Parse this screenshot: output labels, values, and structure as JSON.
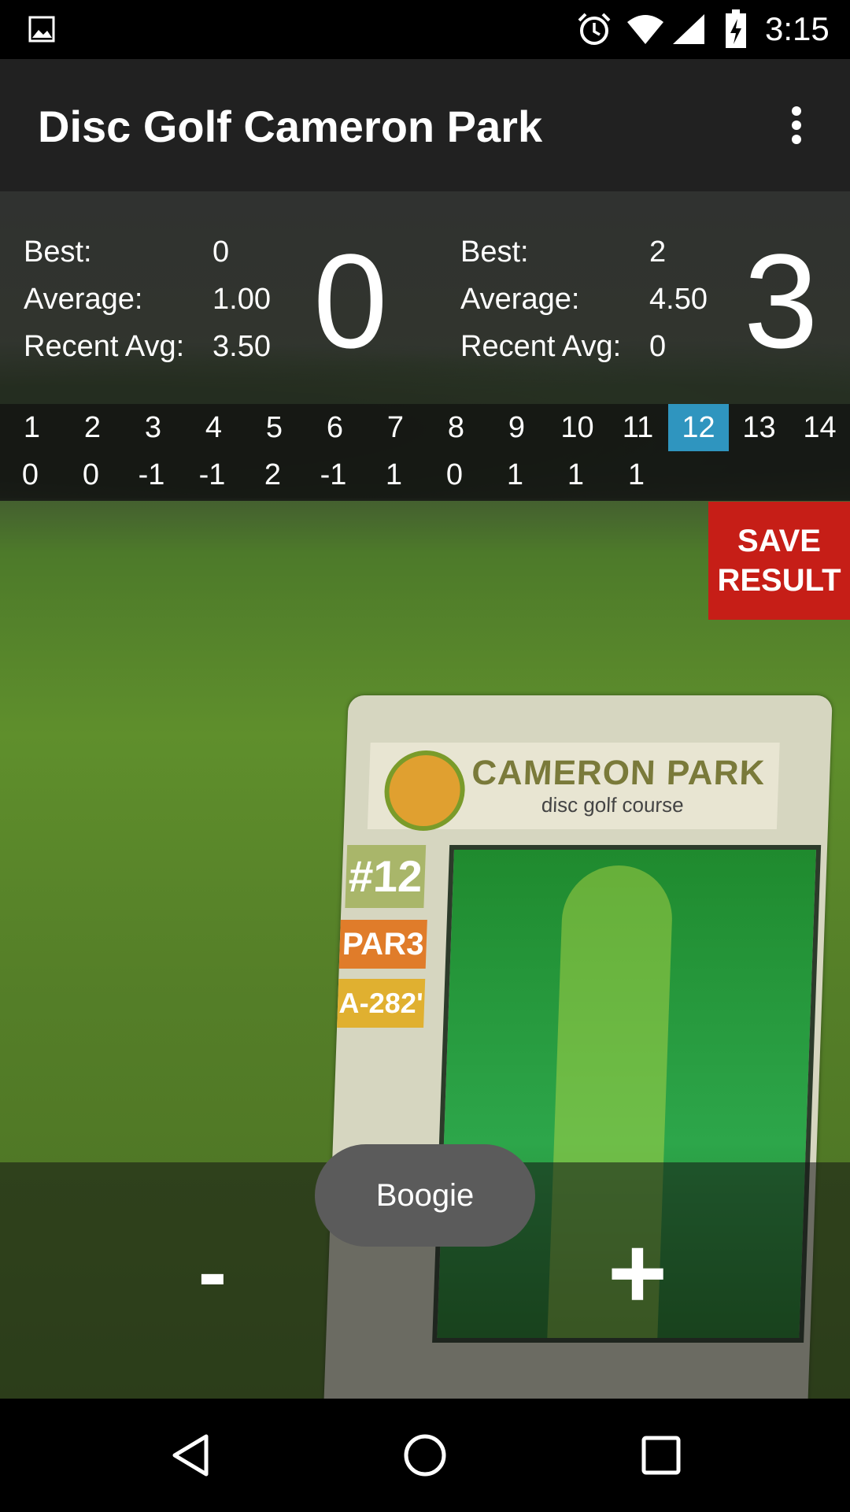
{
  "status_bar": {
    "time": "3:15",
    "icons": [
      "gallery-icon",
      "alarm-icon",
      "wifi-icon",
      "signal-icon",
      "battery-charging-icon"
    ]
  },
  "app_bar": {
    "title": "Disc Golf Cameron Park",
    "menu_icon": "overflow-menu-icon"
  },
  "player_left": {
    "best_label": "Best:",
    "best_value": "0",
    "average_label": "Average:",
    "average_value": "1.00",
    "recent_label": "Recent Avg:",
    "recent_value": "3.50",
    "score": "0"
  },
  "player_right": {
    "best_label": "Best:",
    "best_value": "2",
    "average_label": "Average:",
    "average_value": "4.50",
    "recent_label": "Recent Avg:",
    "recent_value": "0",
    "score": "3"
  },
  "holes": {
    "numbers": [
      "1",
      "2",
      "3",
      "4",
      "5",
      "6",
      "7",
      "8",
      "9",
      "10",
      "11",
      "12",
      "13",
      "14"
    ],
    "scores": [
      "0",
      "0",
      "-1",
      "-1",
      "2",
      "-1",
      "1",
      "0",
      "1",
      "1",
      "1"
    ],
    "selected": "12",
    "selected_color": "#2f95bf"
  },
  "save_button": {
    "line1": "SAVE",
    "line2": "RESULT",
    "color": "#c61e17"
  },
  "controls": {
    "minus_label": "-",
    "plus_label": "+"
  },
  "toast": {
    "text": "Boogie"
  },
  "sign": {
    "title": "CAMERON PARK",
    "subtitle": "disc golf course",
    "hole": "#12",
    "par": "PAR3",
    "distance": "A-282'"
  },
  "nav_bar": {
    "icons": [
      "back-icon",
      "home-icon",
      "recents-icon"
    ]
  }
}
